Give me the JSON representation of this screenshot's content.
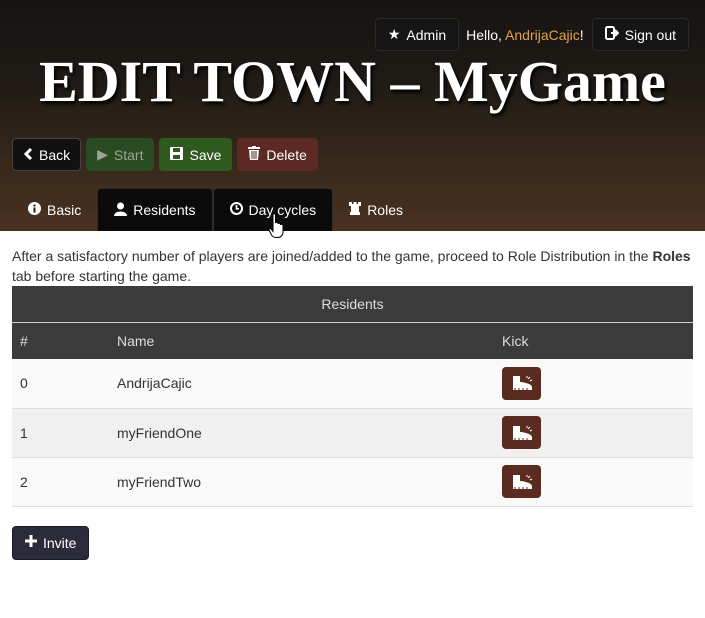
{
  "topbar": {
    "admin_label": "Admin",
    "hello_prefix": "Hello, ",
    "username": "AndrijaCajic",
    "hello_suffix": "!",
    "signout_label": "Sign out"
  },
  "page": {
    "title": "EDIT TOWN – MyGame"
  },
  "actions": {
    "back_label": "Back",
    "start_label": "Start",
    "save_label": "Save",
    "delete_label": "Delete"
  },
  "tabs": [
    {
      "label": "Basic",
      "icon": "info-icon"
    },
    {
      "label": "Residents",
      "icon": "user-icon",
      "active": true
    },
    {
      "label": "Day cycles",
      "icon": "clock-icon"
    },
    {
      "label": "Roles",
      "icon": "rook-icon"
    }
  ],
  "intro": {
    "text_before": "After a satisfactory number of players are joined/added to the game, proceed to Role Distribution in the ",
    "bold": "Roles",
    "text_after": " tab before starting the game."
  },
  "residents_table": {
    "caption": "Residents",
    "columns": [
      "#",
      "Name",
      "Kick"
    ],
    "rows": [
      {
        "index": "0",
        "name": "AndrijaCajic"
      },
      {
        "index": "1",
        "name": "myFriendOne"
      },
      {
        "index": "2",
        "name": "myFriendTwo"
      }
    ]
  },
  "invite_label": "Invite",
  "colors": {
    "username": "#e0a34a",
    "kick_button": "#5a2b20",
    "save_button": "#2e5a1e",
    "delete_button": "#5c2a22",
    "table_header": "#3b3b3b"
  }
}
